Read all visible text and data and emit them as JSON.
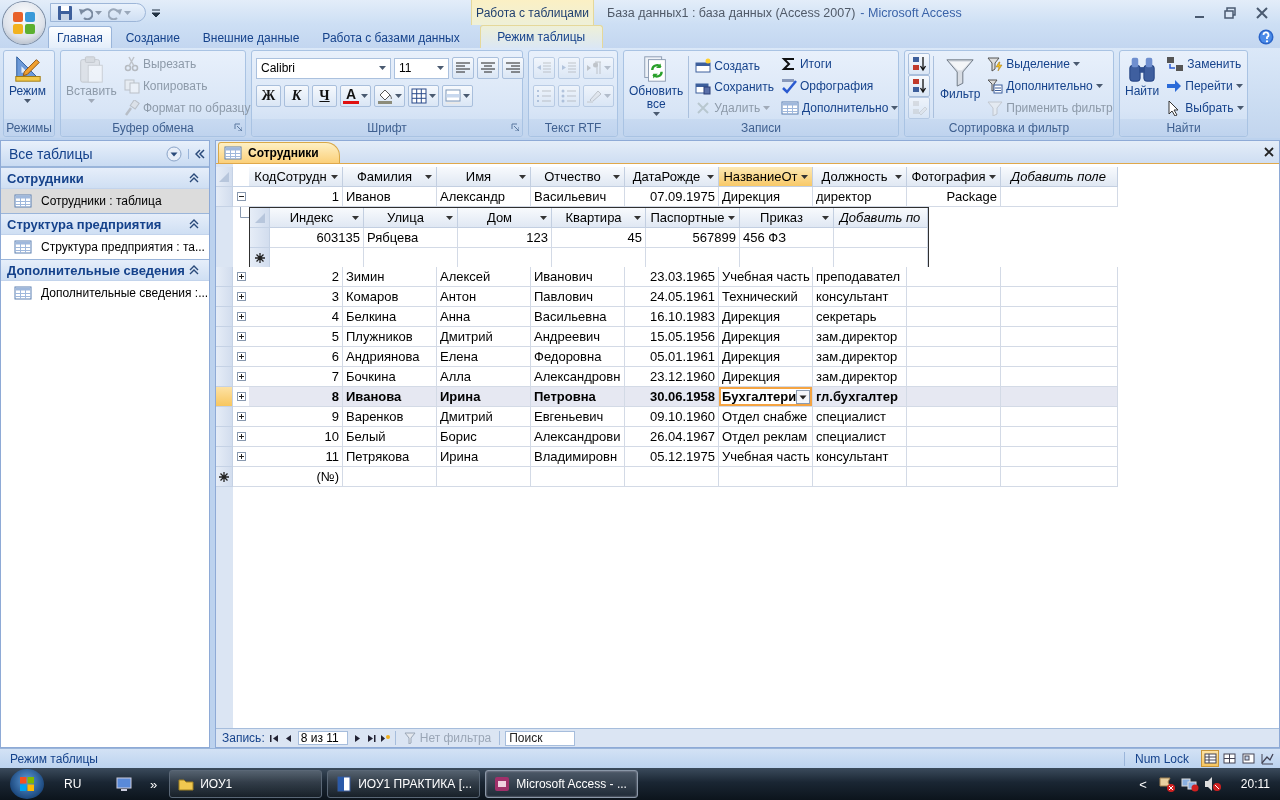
{
  "window": {
    "title": "База данных1 : база данных (Access 2007)",
    "app": "- Microsoft Access",
    "context_group": "Работа с таблицами"
  },
  "tabs": [
    {
      "label": "Главная",
      "selected": true,
      "contextual": false
    },
    {
      "label": "Создание",
      "selected": false,
      "contextual": false
    },
    {
      "label": "Внешние данные",
      "selected": false,
      "contextual": false
    },
    {
      "label": "Работа с базами данных",
      "selected": false,
      "contextual": false
    },
    {
      "label": "Режим таблицы",
      "selected": false,
      "contextual": true
    }
  ],
  "ribbon": {
    "groups": [
      {
        "title": "Режимы",
        "launcher": false,
        "kind": "columns",
        "columns": [
          [
            {
              "kind": "large",
              "label": "Режим",
              "disabled": false,
              "dropdown": true
            }
          ]
        ]
      },
      {
        "title": "Буфер обмена",
        "launcher": true,
        "kind": "columns",
        "columns": [
          [
            {
              "kind": "large",
              "label": "Вставить",
              "disabled": true,
              "dropdown": true
            }
          ],
          [
            {
              "kind": "small",
              "label": "Вырезать",
              "disabled": true,
              "dropdown": false
            },
            {
              "kind": "small",
              "label": "Копировать",
              "disabled": true,
              "dropdown": false
            },
            {
              "kind": "small",
              "label": "Формат по образцу",
              "disabled": true,
              "dropdown": false
            }
          ]
        ]
      },
      {
        "title": "Шрифт",
        "launcher": true,
        "kind": "rows",
        "rows": [
          [
            {
              "kind": "combo",
              "value": "Calibri",
              "disabled": false,
              "dropdown": true
            },
            {
              "kind": "combo",
              "value": "11",
              "disabled": false,
              "dropdown": true
            },
            {
              "kind": "tool",
              "disabled": false,
              "dropdown": false
            },
            {
              "kind": "tool",
              "disabled": false,
              "dropdown": false
            },
            {
              "kind": "tool",
              "disabled": false,
              "dropdown": false
            }
          ],
          [
            {
              "kind": "glyph",
              "label": "Ж",
              "disabled": false,
              "dropdown": false
            },
            {
              "kind": "glyph",
              "label": "К",
              "disabled": false,
              "dropdown": false
            },
            {
              "kind": "glyph",
              "label": "Ч",
              "disabled": false,
              "dropdown": false
            },
            {
              "kind": "glyph",
              "label": "A",
              "disabled": false,
              "dropdown": true
            },
            {
              "kind": "tool",
              "disabled": false,
              "dropdown": true
            },
            {
              "kind": "tool",
              "disabled": false,
              "dropdown": true
            },
            {
              "kind": "tool",
              "disabled": false,
              "dropdown": true
            }
          ]
        ]
      },
      {
        "title": "Текст RTF",
        "launcher": false,
        "kind": "rows",
        "rows": [
          [
            {
              "kind": "tool",
              "disabled": true,
              "dropdown": false
            },
            {
              "kind": "tool",
              "disabled": true,
              "dropdown": false
            },
            {
              "kind": "tool",
              "disabled": true,
              "dropdown": true
            }
          ],
          [
            {
              "kind": "tool",
              "disabled": true,
              "dropdown": false
            },
            {
              "kind": "tool",
              "disabled": true,
              "dropdown": false
            },
            {
              "kind": "tool",
              "disabled": true,
              "dropdown": true
            }
          ]
        ]
      },
      {
        "title": "Записи",
        "launcher": false,
        "kind": "columns",
        "columns": [
          [
            {
              "kind": "large",
              "label": "Обновить все",
              "disabled": false,
              "dropdown": true
            }
          ],
          [
            {
              "kind": "small",
              "label": "Создать",
              "disabled": false,
              "dropdown": false
            },
            {
              "kind": "small",
              "label": "Сохранить",
              "disabled": false,
              "dropdown": false
            },
            {
              "kind": "small",
              "label": "Удалить",
              "disabled": true,
              "dropdown": true
            }
          ],
          [
            {
              "kind": "small",
              "label": "Итоги",
              "disabled": false,
              "dropdown": false
            },
            {
              "kind": "small",
              "label": "Орфография",
              "disabled": false,
              "dropdown": false
            },
            {
              "kind": "small",
              "label": "Дополнительно",
              "disabled": false,
              "dropdown": true
            }
          ]
        ]
      },
      {
        "title": "Сортировка и фильтр",
        "launcher": false,
        "kind": "columns",
        "columns": [
          [
            {
              "kind": "tool",
              "disabled": false,
              "dropdown": false
            },
            {
              "kind": "tool",
              "disabled": false,
              "dropdown": false
            },
            {
              "kind": "tool",
              "disabled": true,
              "dropdown": false
            }
          ],
          [
            {
              "kind": "large",
              "label": "Фильтр",
              "disabled": false,
              "dropdown": false
            }
          ],
          [
            {
              "kind": "small",
              "label": "Выделение",
              "disabled": false,
              "dropdown": true
            },
            {
              "kind": "small",
              "label": "Дополнительно",
              "disabled": false,
              "dropdown": true
            },
            {
              "kind": "small",
              "label": "Применить фильтр",
              "disabled": true,
              "dropdown": false
            }
          ]
        ]
      },
      {
        "title": "Найти",
        "launcher": false,
        "kind": "columns",
        "columns": [
          [
            {
              "kind": "large",
              "label": "Найти",
              "disabled": false,
              "dropdown": false
            }
          ],
          [
            {
              "kind": "small",
              "label": "Заменить",
              "disabled": false,
              "dropdown": false
            },
            {
              "kind": "small",
              "label": "Перейти",
              "disabled": false,
              "dropdown": true
            },
            {
              "kind": "small",
              "label": "Выбрать",
              "disabled": false,
              "dropdown": true
            }
          ]
        ]
      }
    ]
  },
  "nav_pane": {
    "title": "Все таблицы",
    "groups": [
      {
        "title": "Сотрудники",
        "expanded": true,
        "items": [
          {
            "label": "Сотрудники : таблица",
            "selected": true
          }
        ]
      },
      {
        "title": "Структура предприятия",
        "expanded": true,
        "items": [
          {
            "label": "Структура предприятия : та...",
            "selected": false
          }
        ]
      },
      {
        "title": "Дополнительные сведения",
        "expanded": true,
        "items": [
          {
            "label": "Дополнительные сведения :...",
            "selected": false
          }
        ]
      }
    ]
  },
  "document_tab": {
    "title": "Сотрудники"
  },
  "datasheet": {
    "columns": [
      {
        "label": "КодСотрудн",
        "kind": "number",
        "selected": false
      },
      {
        "label": "Фамилия",
        "kind": "text",
        "selected": false
      },
      {
        "label": "Имя",
        "kind": "text",
        "selected": false
      },
      {
        "label": "Отчество",
        "kind": "text",
        "selected": false
      },
      {
        "label": "ДатаРожде",
        "kind": "date",
        "selected": false
      },
      {
        "label": "НазваниеОт",
        "kind": "lookup",
        "selected": true
      },
      {
        "label": "Должность",
        "kind": "text",
        "selected": false
      },
      {
        "label": "Фотография",
        "kind": "object",
        "selected": false
      },
      {
        "label": "Добавить поле",
        "kind": "add",
        "selected": false
      }
    ],
    "rows": [
      {
        "cells": [
          "1",
          "Иванов",
          "Александр",
          "Васильевич",
          "07.09.1975",
          "Дирекция",
          "директор",
          "Package"
        ],
        "expanded": true,
        "selected": false,
        "subdatasheet": {
          "columns": [
            {
              "label": "Индекс",
              "kind": "number"
            },
            {
              "label": "Улица",
              "kind": "text"
            },
            {
              "label": "Дом",
              "kind": "number"
            },
            {
              "label": "Квартира",
              "kind": "number"
            },
            {
              "label": "Паспортные",
              "kind": "number"
            },
            {
              "label": "Приказ",
              "kind": "text"
            },
            {
              "label": "Добавить по",
              "kind": "add"
            }
          ],
          "rows": [
            {
              "cells": [
                "603135",
                "Рябцева",
                "123",
                "45",
                "567899",
                "456 ФЗ"
              ]
            }
          ]
        }
      },
      {
        "cells": [
          "2",
          "Зимин",
          "Алексей",
          "Иванович",
          "23.03.1965",
          "Учебная часть",
          "преподавател",
          null
        ],
        "expanded": false,
        "selected": false
      },
      {
        "cells": [
          "3",
          "Комаров",
          "Антон",
          "Павлович",
          "24.05.1961",
          "Технический",
          "консультант",
          null
        ],
        "expanded": false,
        "selected": false
      },
      {
        "cells": [
          "4",
          "Белкина",
          "Анна",
          "Васильевна",
          "16.10.1983",
          "Дирекция",
          "секретарь",
          null
        ],
        "expanded": false,
        "selected": false
      },
      {
        "cells": [
          "5",
          "Плужников",
          "Дмитрий",
          "Андреевич",
          "15.05.1956",
          "Дирекция",
          "зам.директор",
          null
        ],
        "expanded": false,
        "selected": false
      },
      {
        "cells": [
          "6",
          "Андриянова",
          "Елена",
          "Федоровна",
          "05.01.1961",
          "Дирекция",
          "зам.директор",
          null
        ],
        "expanded": false,
        "selected": false
      },
      {
        "cells": [
          "7",
          "Бочкина",
          "Алла",
          "Александровн",
          "23.12.1960",
          "Дирекция",
          "зам.директор",
          null
        ],
        "expanded": false,
        "selected": false
      },
      {
        "cells": [
          "8",
          "Иванова",
          "Ирина",
          "Петровна",
          "30.06.1958",
          "Бухгалтери",
          "гл.бухгалтер",
          null
        ],
        "expanded": false,
        "selected": true
      },
      {
        "cells": [
          "9",
          "Варенков",
          "Дмитрий",
          "Евгеньевич",
          "09.10.1960",
          "Отдел снабже",
          "специалист",
          null
        ],
        "expanded": false,
        "selected": false
      },
      {
        "cells": [
          "10",
          "Белый",
          "Борис",
          "Александрови",
          "26.04.1967",
          "Отдел реклам",
          "специалист",
          null
        ],
        "expanded": false,
        "selected": false
      },
      {
        "cells": [
          "11",
          "Петрякова",
          "Ирина",
          "Владимировн",
          "05.12.1975",
          "Учебная часть",
          "консультант",
          null
        ],
        "expanded": false,
        "selected": false
      }
    ],
    "new_row": {
      "cells": [
        "(№)"
      ]
    }
  },
  "record_nav": {
    "label": "Запись:",
    "position": "8 из 11",
    "filter": {
      "label": "Нет фильтра",
      "disabled": true
    },
    "search": {
      "placeholder": "Поиск"
    }
  },
  "status_bar": {
    "text": "Режим таблицы",
    "indicator": "Num Lock",
    "views": [
      {
        "selected": true
      },
      {
        "selected": false
      },
      {
        "selected": false
      },
      {
        "selected": false
      }
    ]
  },
  "taskbar": {
    "language": "RU",
    "overflow": "»",
    "buttons": [
      {
        "label": "ИОУ1",
        "selected": false
      },
      {
        "label": "ИОУ1 ПРАКТИКА [...",
        "selected": false
      },
      {
        "label": "Microsoft Access - ...",
        "selected": true
      }
    ],
    "tray_expand": "<",
    "clock": "20:11"
  }
}
